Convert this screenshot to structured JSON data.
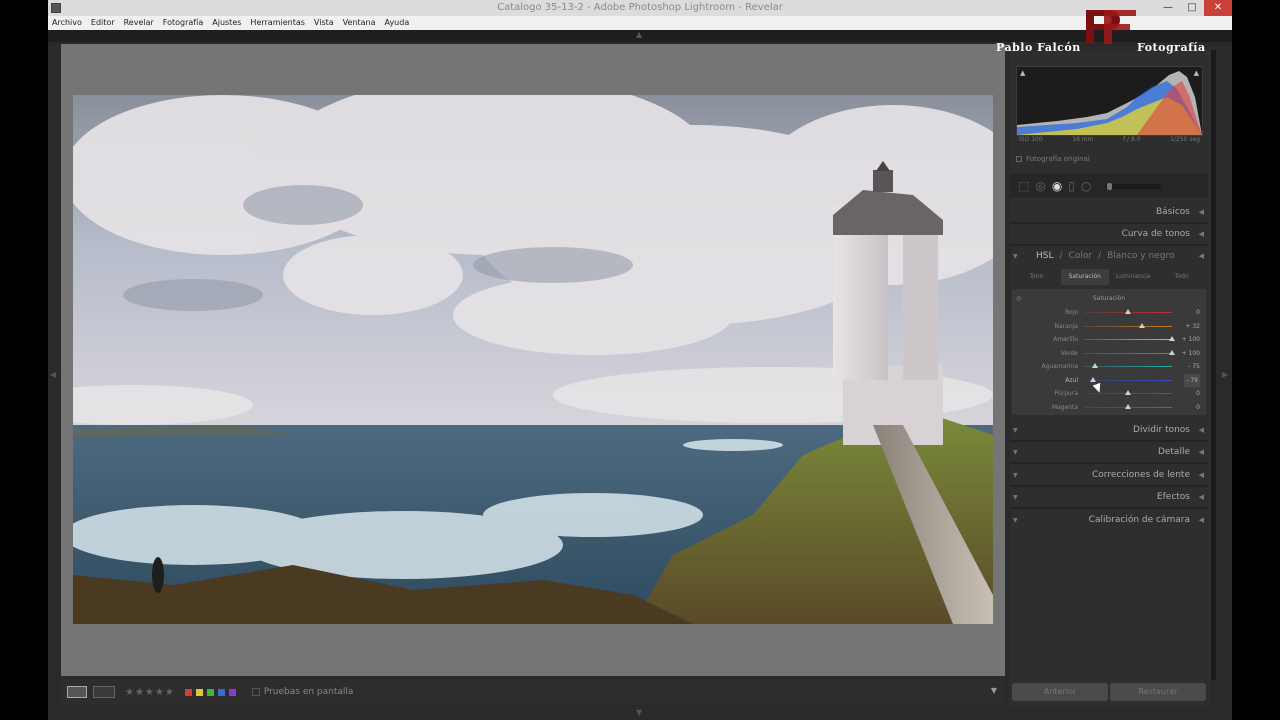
{
  "window": {
    "title": "Catalogo 35-13-2 - Adobe Photoshop Lightroom - Revelar",
    "minimize_icon": "minimize-icon",
    "maximize_icon": "maximize-icon",
    "close_icon": "close-icon"
  },
  "menu": [
    "Archivo",
    "Editor",
    "Revelar",
    "Fotografía",
    "Ajustes",
    "Herramientas",
    "Vista",
    "Ventana",
    "Ayuda"
  ],
  "watermark": {
    "monogram": "PF",
    "left": "Pablo Falcón",
    "right": "Fotografía"
  },
  "histogram": {
    "meta": [
      "ISO 100",
      "16 mm",
      "f / 8.0",
      "1/250 seg"
    ],
    "original_photo_label": "Fotografía original"
  },
  "sections": {
    "basic": "Básicos",
    "tone_curve": "Curva de tonos",
    "split_toning": "Dividir tonos",
    "detail": "Detalle",
    "lens": "Correcciones de lente",
    "effects": "Efectos",
    "calibration": "Calibración de cámara"
  },
  "hsl": {
    "modes": [
      "HSL",
      "Color",
      "Blanco y negro"
    ],
    "separator": "/",
    "tabs": [
      "Tono",
      "Saturación",
      "Luminancia",
      "Todo"
    ],
    "active_tab": 1,
    "group_title": "Saturación",
    "sliders": [
      {
        "label": "Rojo",
        "value": "0",
        "fraction": 0.5,
        "color_start": "#5c3a3a",
        "color_end": "#c03030"
      },
      {
        "label": "Naranja",
        "value": "+ 32",
        "fraction": 0.66,
        "color_start": "#5a4a3a",
        "color_end": "#d07a20"
      },
      {
        "label": "Amarillo",
        "value": "+ 100",
        "fraction": 1.0,
        "color_start": "#5a5a3a",
        "color_end": "#d0c020"
      },
      {
        "label": "Verde",
        "value": "+ 100",
        "fraction": 1.0,
        "color_start": "#3a5a3a",
        "color_end": "#30b030"
      },
      {
        "label": "Aguamarina",
        "value": "- 75",
        "fraction": 0.125,
        "color_start": "#3a5a5a",
        "color_end": "#20b0b0"
      },
      {
        "label": "Azul",
        "value": "- 79",
        "fraction": 0.105,
        "color_start": "#3a3a5a",
        "color_end": "#3050d0"
      },
      {
        "label": "Púrpura",
        "value": "0",
        "fraction": 0.5,
        "color_start": "#4a3a5a",
        "color_end": "#8030c0"
      },
      {
        "label": "Magenta",
        "value": "0",
        "fraction": 0.5,
        "color_start": "#5a3a4a",
        "color_end": "#c030a0"
      }
    ],
    "active_slider": 5
  },
  "toolbar": {
    "stars": "★★★★★",
    "labels": [
      "#d83a3a",
      "#d8c83a",
      "#3ab83a",
      "#3a6ad8",
      "#8a3ad8"
    ],
    "proof_label": "Pruebas en pantalla"
  },
  "buttons": {
    "previous": "Anterior",
    "reset": "Restaurar"
  }
}
